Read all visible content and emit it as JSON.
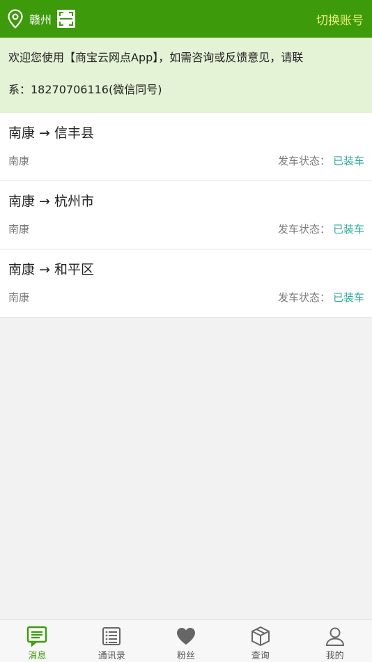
{
  "header": {
    "city": "赣州",
    "switch_label": "切换账号"
  },
  "notice": {
    "line1": "欢迎您使用【商宝云网点App】，如需咨询或反馈意见，请联",
    "line2": "系：18270706116(微信同号)"
  },
  "shipments": [
    {
      "route": "南康 → 信丰县",
      "from": "南康",
      "status_label": "发车状态：",
      "status_value": "已装车"
    },
    {
      "route": "南康 → 杭州市",
      "from": "南康",
      "status_label": "发车状态：",
      "status_value": "已装车"
    },
    {
      "route": "南康 → 和平区",
      "from": "南康",
      "status_label": "发车状态：",
      "status_value": "已装车"
    }
  ],
  "tabs": [
    {
      "label": "消息",
      "icon": "message-icon",
      "active": true
    },
    {
      "label": "通讯录",
      "icon": "contacts-icon",
      "active": false
    },
    {
      "label": "粉丝",
      "icon": "heart-icon",
      "active": false
    },
    {
      "label": "查询",
      "icon": "box-icon",
      "active": false
    },
    {
      "label": "我的",
      "icon": "profile-icon",
      "active": false
    }
  ],
  "colors": {
    "header": "#3d9a0a",
    "notice_bg": "#e4f2d6",
    "status_value": "#2ba89a",
    "switch_text": "#e8f07a"
  }
}
